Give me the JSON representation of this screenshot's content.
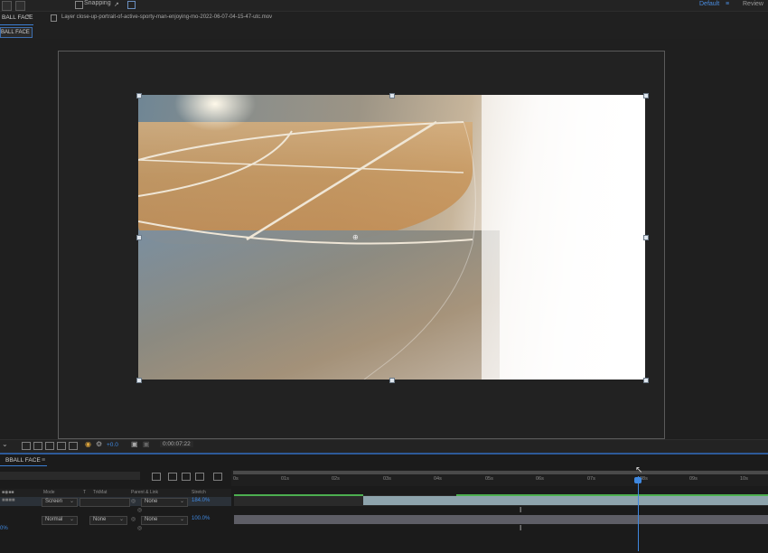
{
  "toolbar": {
    "snapping_label": "Snapping",
    "workspace_default": "Default",
    "workspace_menu": "≡",
    "workspace_review": "Review"
  },
  "panels": {
    "comp_tab_label": "BALL FACE",
    "comp_tab_menu": "≡",
    "layer_tab_label": "Layer close-up-portrait-of-active-sporty-man-enjoying-mo-2022-06-07-04-15-47-utc.mov",
    "sub_tab_label": "BALL FACE"
  },
  "viewer_bar": {
    "exposure_value": "+0.0",
    "timecode": "0:00:07:22"
  },
  "timeline": {
    "tab_label": "BBALL FACE",
    "tab_menu": "≡",
    "columns": {
      "mode": "Mode",
      "t": "T",
      "trkmat": "TrkMat",
      "parent": "Parent & Link",
      "stretch": "Stretch"
    },
    "ruler_ticks": [
      "0s",
      "01s",
      "02s",
      "03s",
      "04s",
      "05s",
      "06s",
      "07s",
      "08s",
      "09s",
      "10s"
    ],
    "layers": [
      {
        "mode": "Screen",
        "trkmat": "",
        "parent": "None",
        "stretch": "184.0%"
      },
      {
        "mode": "Normal",
        "trkmat": "None",
        "parent": "None",
        "stretch": "100.0%",
        "left_value": "0%"
      }
    ]
  },
  "colors": {
    "accent_blue": "#3f88e0",
    "track_green": "#4caf50",
    "clip_color": "#8ea4ad"
  }
}
